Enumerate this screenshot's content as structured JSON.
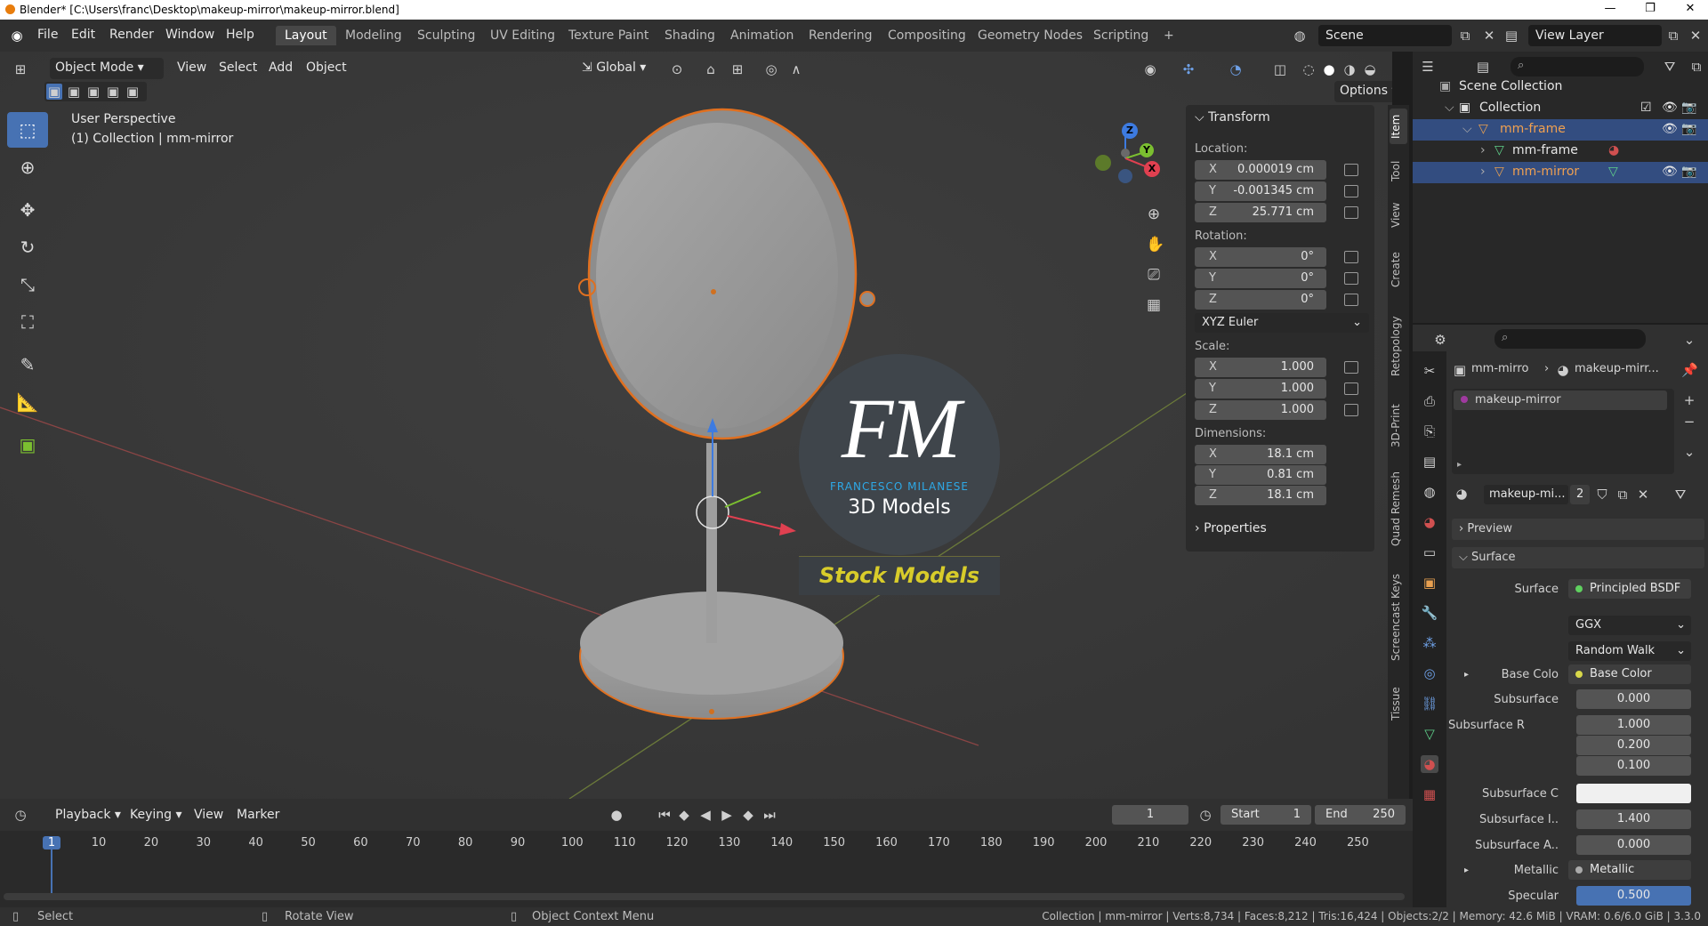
{
  "window": {
    "title": "Blender* [C:\\Users\\franc\\Desktop\\makeup-mirror\\makeup-mirror.blend]",
    "controls": [
      "—",
      "❐",
      "✕"
    ]
  },
  "menu": {
    "items": [
      "File",
      "Edit",
      "Render",
      "Window",
      "Help"
    ],
    "workspaces": [
      "Layout",
      "Modeling",
      "Sculpting",
      "UV Editing",
      "Texture Paint",
      "Shading",
      "Animation",
      "Rendering",
      "Compositing",
      "Geometry Nodes",
      "Scripting"
    ],
    "active_workspace": "Layout",
    "add_tab": "+",
    "scene": "Scene",
    "view_layer": "View Layer"
  },
  "viewport": {
    "mode": "Object Mode",
    "menus": [
      "View",
      "Select",
      "Add",
      "Object"
    ],
    "orientation": "Global",
    "options": "Options",
    "perspective": "User Perspective",
    "collection_info": "(1) Collection | mm-mirror",
    "gizmo": {
      "z": "Z",
      "y": "Y",
      "x": "X"
    },
    "watermark": {
      "letters": "FM",
      "name": "FRANCESCO MILANESE",
      "sub": "3D Models",
      "stock": "Stock Models"
    }
  },
  "npanel": {
    "title": "Transform",
    "location_label": "Location:",
    "location": [
      {
        "axis": "X",
        "value": "0.000019 cm"
      },
      {
        "axis": "Y",
        "value": "-0.001345 cm"
      },
      {
        "axis": "Z",
        "value": "25.771 cm"
      }
    ],
    "rotation_label": "Rotation:",
    "rotation": [
      {
        "axis": "X",
        "value": "0°"
      },
      {
        "axis": "Y",
        "value": "0°"
      },
      {
        "axis": "Z",
        "value": "0°"
      }
    ],
    "rotation_mode": "XYZ Euler",
    "scale_label": "Scale:",
    "scale": [
      {
        "axis": "X",
        "value": "1.000"
      },
      {
        "axis": "Y",
        "value": "1.000"
      },
      {
        "axis": "Z",
        "value": "1.000"
      }
    ],
    "dimensions_label": "Dimensions:",
    "dimensions": [
      {
        "axis": "X",
        "value": "18.1 cm"
      },
      {
        "axis": "Y",
        "value": "0.81 cm"
      },
      {
        "axis": "Z",
        "value": "18.1 cm"
      }
    ],
    "properties": "Properties"
  },
  "side_tabs": [
    "Item",
    "Tool",
    "View",
    "Create",
    "Retopology",
    "3D-Print",
    "Quad Remesh",
    "Screencast Keys",
    "Tissue"
  ],
  "outliner": {
    "rows": [
      {
        "label": "Scene Collection"
      },
      {
        "label": "Collection"
      },
      {
        "label": "mm-frame"
      },
      {
        "label": "mm-frame"
      },
      {
        "label": "mm-mirror"
      }
    ]
  },
  "properties": {
    "breadcrumb": [
      "mm-mirro",
      "makeup-mirr..."
    ],
    "slot": "makeup-mirror",
    "material_name": "makeup-mi...",
    "users": "2",
    "preview": "Preview",
    "surface": "Surface",
    "surface_label": "Surface",
    "surface_value": "Principled BSDF",
    "distribution": "GGX",
    "subsurface_method": "Random Walk",
    "rows": [
      {
        "label": "Base Colo",
        "value": "Base Color"
      },
      {
        "label": "Subsurface",
        "value": "0.000"
      },
      {
        "label": "Subsurface R",
        "value": "1.000"
      },
      {
        "label": "",
        "value": "0.200"
      },
      {
        "label": "",
        "value": "0.100"
      },
      {
        "label": "Subsurface C",
        "value": ""
      },
      {
        "label": "Subsurface I..",
        "value": "1.400"
      },
      {
        "label": "Subsurface A..",
        "value": "0.000"
      },
      {
        "label": "Metallic",
        "value": "Metallic"
      },
      {
        "label": "Specular",
        "value": "0.500"
      }
    ]
  },
  "timeline": {
    "menus": [
      "Playback",
      "Keying",
      "View",
      "Marker"
    ],
    "current_frame": "1",
    "start_label": "Start",
    "start": "1",
    "end_label": "End",
    "end": "250",
    "ticks": [
      "1",
      "10",
      "20",
      "30",
      "40",
      "50",
      "60",
      "70",
      "80",
      "90",
      "100",
      "110",
      "120",
      "130",
      "140",
      "150",
      "160",
      "170",
      "180",
      "190",
      "200",
      "210",
      "220",
      "230",
      "240",
      "250"
    ]
  },
  "status": {
    "select": "Select",
    "rotate": "Rotate View",
    "context": "Object Context Menu",
    "info": "Collection | mm-mirror | Verts:8,734 | Faces:8,212 | Tris:16,424 | Objects:2/2 | Memory: 42.6 MiB | VRAM: 0.6/6.0 GiB | 3.3.0"
  }
}
